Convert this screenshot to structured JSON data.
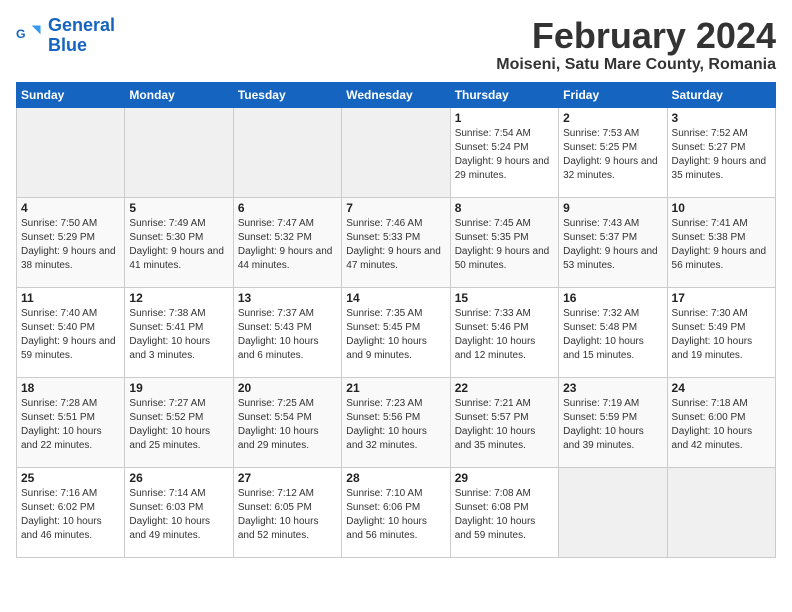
{
  "logo": {
    "line1": "General",
    "line2": "Blue"
  },
  "title": "February 2024",
  "location": "Moiseni, Satu Mare County, Romania",
  "days_header": [
    "Sunday",
    "Monday",
    "Tuesday",
    "Wednesday",
    "Thursday",
    "Friday",
    "Saturday"
  ],
  "weeks": [
    [
      {
        "day": "",
        "info": ""
      },
      {
        "day": "",
        "info": ""
      },
      {
        "day": "",
        "info": ""
      },
      {
        "day": "",
        "info": ""
      },
      {
        "day": "1",
        "info": "Sunrise: 7:54 AM\nSunset: 5:24 PM\nDaylight: 9 hours and 29 minutes."
      },
      {
        "day": "2",
        "info": "Sunrise: 7:53 AM\nSunset: 5:25 PM\nDaylight: 9 hours and 32 minutes."
      },
      {
        "day": "3",
        "info": "Sunrise: 7:52 AM\nSunset: 5:27 PM\nDaylight: 9 hours and 35 minutes."
      }
    ],
    [
      {
        "day": "4",
        "info": "Sunrise: 7:50 AM\nSunset: 5:29 PM\nDaylight: 9 hours and 38 minutes."
      },
      {
        "day": "5",
        "info": "Sunrise: 7:49 AM\nSunset: 5:30 PM\nDaylight: 9 hours and 41 minutes."
      },
      {
        "day": "6",
        "info": "Sunrise: 7:47 AM\nSunset: 5:32 PM\nDaylight: 9 hours and 44 minutes."
      },
      {
        "day": "7",
        "info": "Sunrise: 7:46 AM\nSunset: 5:33 PM\nDaylight: 9 hours and 47 minutes."
      },
      {
        "day": "8",
        "info": "Sunrise: 7:45 AM\nSunset: 5:35 PM\nDaylight: 9 hours and 50 minutes."
      },
      {
        "day": "9",
        "info": "Sunrise: 7:43 AM\nSunset: 5:37 PM\nDaylight: 9 hours and 53 minutes."
      },
      {
        "day": "10",
        "info": "Sunrise: 7:41 AM\nSunset: 5:38 PM\nDaylight: 9 hours and 56 minutes."
      }
    ],
    [
      {
        "day": "11",
        "info": "Sunrise: 7:40 AM\nSunset: 5:40 PM\nDaylight: 9 hours and 59 minutes."
      },
      {
        "day": "12",
        "info": "Sunrise: 7:38 AM\nSunset: 5:41 PM\nDaylight: 10 hours and 3 minutes."
      },
      {
        "day": "13",
        "info": "Sunrise: 7:37 AM\nSunset: 5:43 PM\nDaylight: 10 hours and 6 minutes."
      },
      {
        "day": "14",
        "info": "Sunrise: 7:35 AM\nSunset: 5:45 PM\nDaylight: 10 hours and 9 minutes."
      },
      {
        "day": "15",
        "info": "Sunrise: 7:33 AM\nSunset: 5:46 PM\nDaylight: 10 hours and 12 minutes."
      },
      {
        "day": "16",
        "info": "Sunrise: 7:32 AM\nSunset: 5:48 PM\nDaylight: 10 hours and 15 minutes."
      },
      {
        "day": "17",
        "info": "Sunrise: 7:30 AM\nSunset: 5:49 PM\nDaylight: 10 hours and 19 minutes."
      }
    ],
    [
      {
        "day": "18",
        "info": "Sunrise: 7:28 AM\nSunset: 5:51 PM\nDaylight: 10 hours and 22 minutes."
      },
      {
        "day": "19",
        "info": "Sunrise: 7:27 AM\nSunset: 5:52 PM\nDaylight: 10 hours and 25 minutes."
      },
      {
        "day": "20",
        "info": "Sunrise: 7:25 AM\nSunset: 5:54 PM\nDaylight: 10 hours and 29 minutes."
      },
      {
        "day": "21",
        "info": "Sunrise: 7:23 AM\nSunset: 5:56 PM\nDaylight: 10 hours and 32 minutes."
      },
      {
        "day": "22",
        "info": "Sunrise: 7:21 AM\nSunset: 5:57 PM\nDaylight: 10 hours and 35 minutes."
      },
      {
        "day": "23",
        "info": "Sunrise: 7:19 AM\nSunset: 5:59 PM\nDaylight: 10 hours and 39 minutes."
      },
      {
        "day": "24",
        "info": "Sunrise: 7:18 AM\nSunset: 6:00 PM\nDaylight: 10 hours and 42 minutes."
      }
    ],
    [
      {
        "day": "25",
        "info": "Sunrise: 7:16 AM\nSunset: 6:02 PM\nDaylight: 10 hours and 46 minutes."
      },
      {
        "day": "26",
        "info": "Sunrise: 7:14 AM\nSunset: 6:03 PM\nDaylight: 10 hours and 49 minutes."
      },
      {
        "day": "27",
        "info": "Sunrise: 7:12 AM\nSunset: 6:05 PM\nDaylight: 10 hours and 52 minutes."
      },
      {
        "day": "28",
        "info": "Sunrise: 7:10 AM\nSunset: 6:06 PM\nDaylight: 10 hours and 56 minutes."
      },
      {
        "day": "29",
        "info": "Sunrise: 7:08 AM\nSunset: 6:08 PM\nDaylight: 10 hours and 59 minutes."
      },
      {
        "day": "",
        "info": ""
      },
      {
        "day": "",
        "info": ""
      }
    ]
  ]
}
